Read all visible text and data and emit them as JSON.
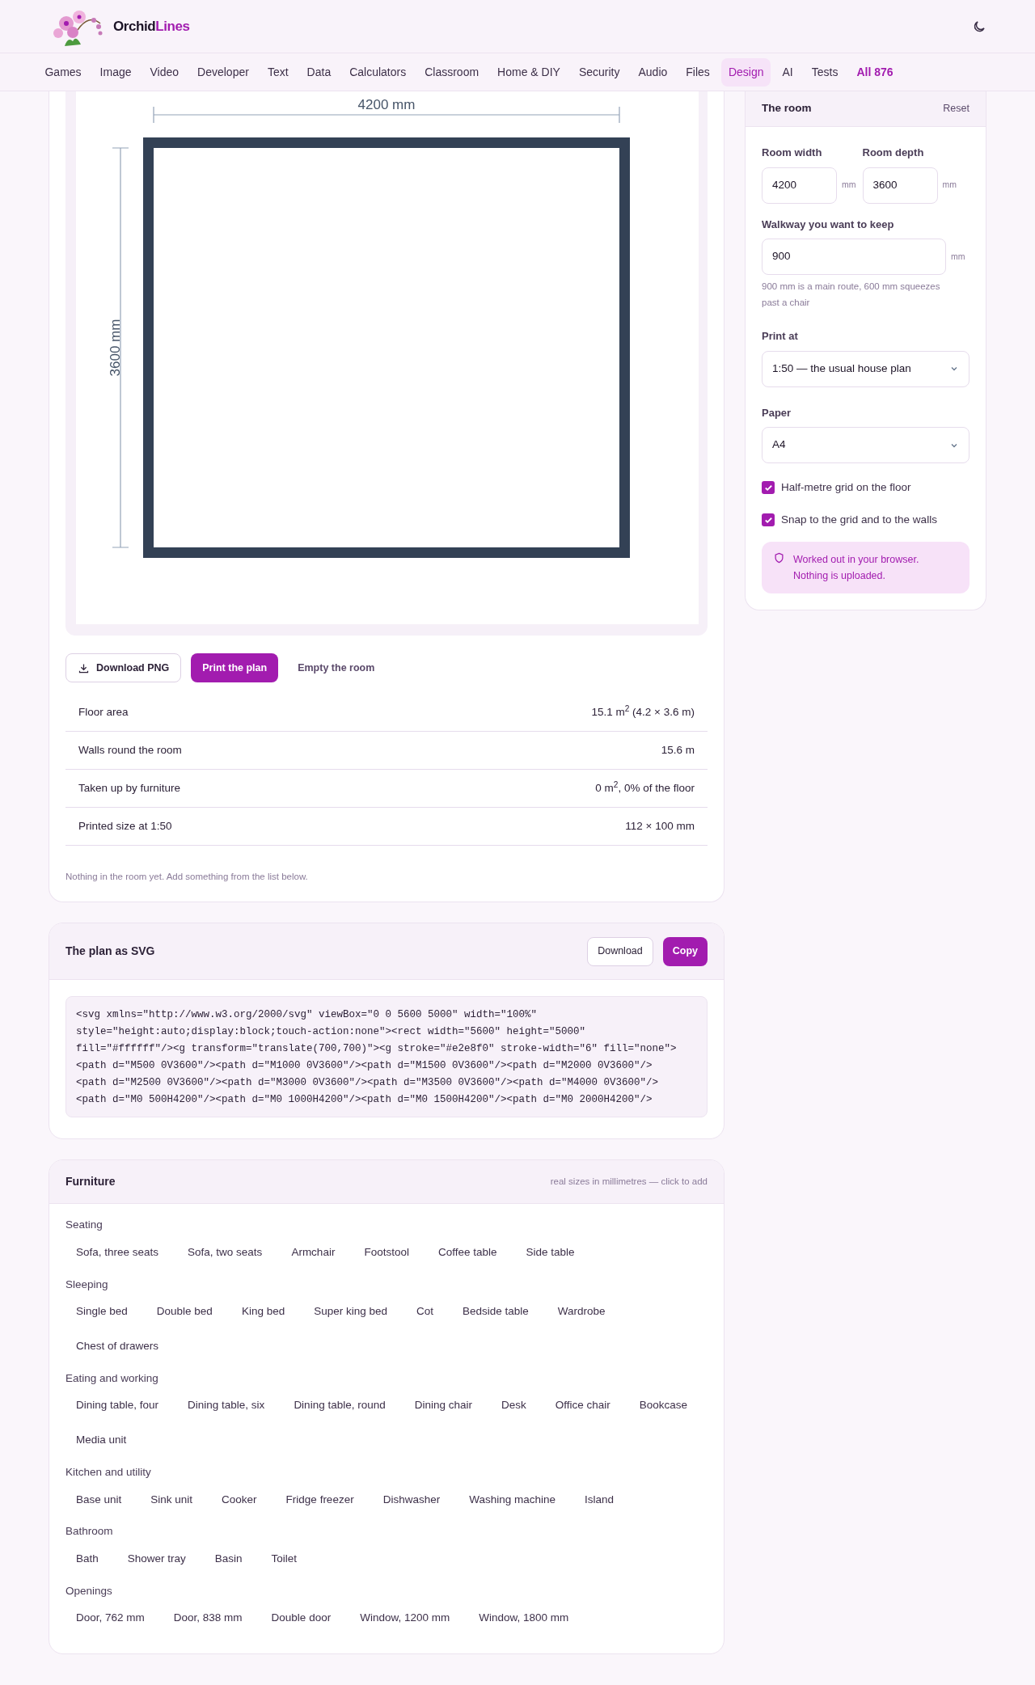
{
  "header": {
    "brand_first": "Orchid",
    "brand_second": "Lines"
  },
  "nav": [
    {
      "label": "Games",
      "selected": false,
      "kind": "link"
    },
    {
      "label": "Image",
      "selected": false,
      "kind": "link"
    },
    {
      "label": "Video",
      "selected": false,
      "kind": "link"
    },
    {
      "label": "Developer",
      "selected": false,
      "kind": "link"
    },
    {
      "label": "Text",
      "selected": false,
      "kind": "link"
    },
    {
      "label": "Data",
      "selected": false,
      "kind": "link"
    },
    {
      "label": "Calculators",
      "selected": false,
      "kind": "link"
    },
    {
      "label": "Classroom",
      "selected": false,
      "kind": "link"
    },
    {
      "label": "Home & DIY",
      "selected": false,
      "kind": "link"
    },
    {
      "label": "Security",
      "selected": false,
      "kind": "link"
    },
    {
      "label": "Audio",
      "selected": false,
      "kind": "link"
    },
    {
      "label": "Files",
      "selected": false,
      "kind": "link"
    },
    {
      "label": "Design",
      "selected": true,
      "kind": "link"
    },
    {
      "label": "AI",
      "selected": false,
      "kind": "link"
    },
    {
      "label": "Tests",
      "selected": false,
      "kind": "link"
    },
    {
      "label": "All 876",
      "selected": false,
      "kind": "all"
    }
  ],
  "plan": {
    "width_label": "4200 mm",
    "depth_label": "3600 mm"
  },
  "actions": [
    {
      "label": "Download PNG",
      "kind": "outline"
    },
    {
      "label": "Print the plan",
      "kind": "primary"
    },
    {
      "label": "Empty the room",
      "kind": "ghost"
    }
  ],
  "stats": [
    {
      "label": "Floor area",
      "value": "15.1 m$^{2}$ (4.2 × 3.6 m)"
    },
    {
      "label": "Walls round the room",
      "value": "15.6 m"
    },
    {
      "label": "Taken up by furniture",
      "value": "0 m$^{2}$, 0% of the floor"
    },
    {
      "label": "Printed size at 1:50",
      "value": "112 × 100 mm"
    }
  ],
  "empty_note": "Nothing in the room yet. Add something from the list below.",
  "svg_card": {
    "title": "The plan as SVG",
    "buttons": [
      {
        "label": "Download",
        "kind": "outline"
      },
      {
        "label": "Copy",
        "kind": "primary"
      }
    ],
    "code": "<svg xmlns=\"http://www.w3.org/2000/svg\" viewBox=\"0 0 5600 5000\" width=\"100%\"\nstyle=\"height:auto;display:block;touch-action:none\"><rect width=\"5600\" height=\"5000\"\nfill=\"#ffffff\"/><g transform=\"translate(700,700)\"><g stroke=\"#e2e8f0\" stroke-width=\"6\" fill=\"none\">\n<path d=\"M500 0V3600\"/><path d=\"M1000 0V3600\"/><path d=\"M1500 0V3600\"/><path d=\"M2000 0V3600\"/>\n<path d=\"M2500 0V3600\"/><path d=\"M3000 0V3600\"/><path d=\"M3500 0V3600\"/><path d=\"M4000 0V3600\"/>\n<path d=\"M0 500H4200\"/><path d=\"M0 1000H4200\"/><path d=\"M0 1500H4200\"/><path d=\"M0 2000H4200\"/>"
  },
  "furniture": {
    "title": "Furniture",
    "hint": "real sizes in millimetres — click to add",
    "groups": [
      {
        "name": "Seating",
        "items": [
          "Sofa, three seats",
          "Sofa, two seats",
          "Armchair",
          "Footstool",
          "Coffee table",
          "Side table"
        ]
      },
      {
        "name": "Sleeping",
        "items": [
          "Single bed",
          "Double bed",
          "King bed",
          "Super king bed",
          "Cot",
          "Bedside table",
          "Wardrobe",
          "Chest of drawers"
        ]
      },
      {
        "name": "Eating and working",
        "items": [
          "Dining table, four",
          "Dining table, six",
          "Dining table, round",
          "Dining chair",
          "Desk",
          "Office chair",
          "Bookcase",
          "Media unit"
        ]
      },
      {
        "name": "Kitchen and utility",
        "items": [
          "Base unit",
          "Sink unit",
          "Cooker",
          "Fridge freezer",
          "Dishwasher",
          "Washing machine",
          "Island"
        ]
      },
      {
        "name": "Bathroom",
        "items": [
          "Bath",
          "Shower tray",
          "Basin",
          "Toilet"
        ]
      },
      {
        "name": "Openings",
        "items": [
          "Door, 762 mm",
          "Door, 838 mm",
          "Double door",
          "Window, 1200 mm",
          "Window, 1800 mm"
        ]
      }
    ]
  },
  "room": {
    "title": "The room",
    "reset": "Reset",
    "width": {
      "label": "Room width",
      "value": "4200",
      "unit": "mm"
    },
    "depth": {
      "label": "Room depth",
      "value": "3600",
      "unit": "mm"
    },
    "walkway": {
      "label": "Walkway you want to keep",
      "value": "900",
      "unit": "mm",
      "hint": "900 mm is a main route, 600 mm squeezes past a chair"
    },
    "print_at": {
      "label": "Print at",
      "value": "1:50 — the usual house plan"
    },
    "paper": {
      "label": "Paper",
      "value": "A4"
    },
    "options": [
      {
        "label": "Half-metre grid on the floor",
        "checked": true
      },
      {
        "label": "Snap to the grid and to the walls",
        "checked": true
      }
    ],
    "privacy": "Worked out in your browser. Nothing is uploaded."
  }
}
